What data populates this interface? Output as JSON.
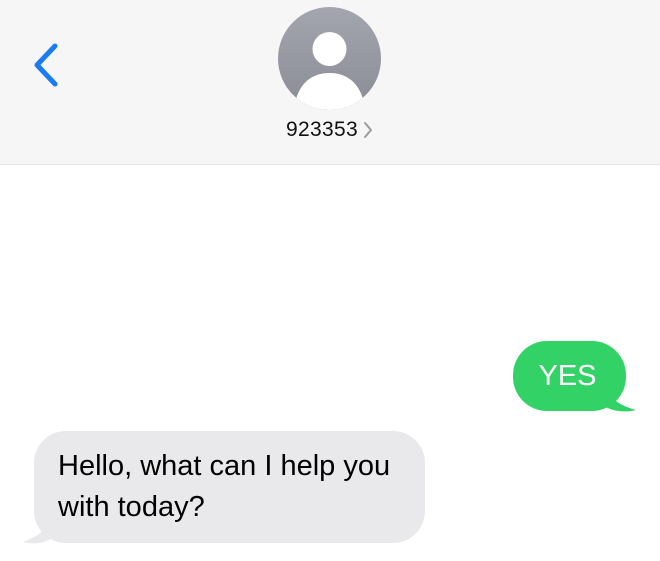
{
  "header": {
    "back_icon": "chevron-left-icon",
    "avatar_icon": "person-silhouette-icon",
    "contact_name": "923353",
    "contact_chevron_icon": "chevron-right-icon"
  },
  "messages": [
    {
      "direction": "sent",
      "text": "YES"
    },
    {
      "direction": "received",
      "text": "Hello, what can I help you with today?"
    }
  ],
  "colors": {
    "accent_blue": "#1a7cf5",
    "sent_bubble": "#33d267",
    "received_bubble": "#e9e9eb",
    "header_bg": "#f6f6f6",
    "avatar_bg": "#969aa3"
  }
}
